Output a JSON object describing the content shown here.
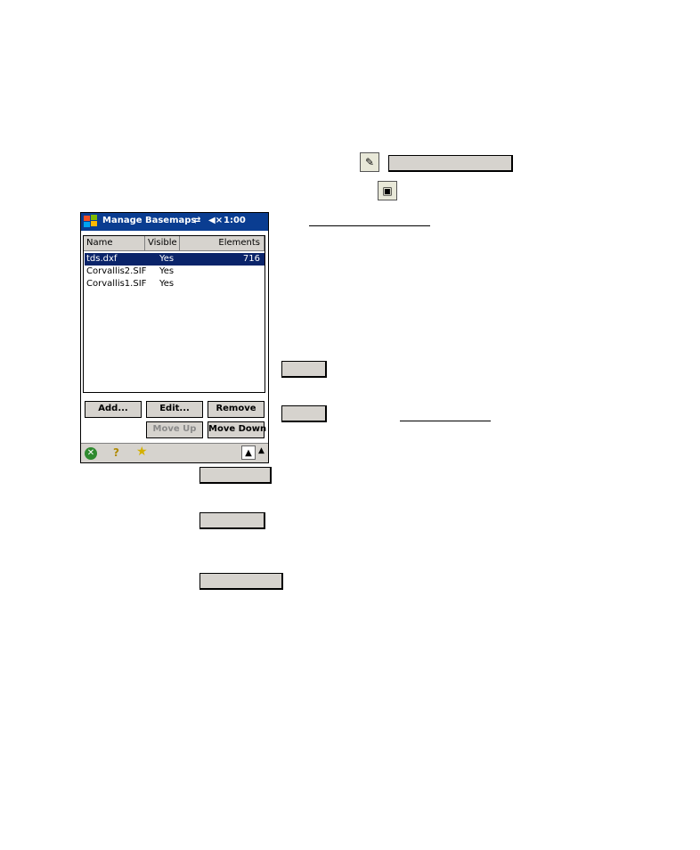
{
  "window": {
    "title": "Manage Basemaps",
    "connectivity_icon": "sync-arrows-icon",
    "volume_icon": "speaker-muted-icon",
    "time": "1:00"
  },
  "list": {
    "columns": [
      "Name",
      "Visible",
      "Elements"
    ],
    "rows": [
      {
        "name": "tds.dxf",
        "visible": "Yes",
        "elements": "716",
        "selected": true
      },
      {
        "name": "Corvallis2.SIF",
        "visible": "Yes",
        "elements": ""
      },
      {
        "name": "Corvallis1.SIF",
        "visible": "Yes",
        "elements": ""
      }
    ]
  },
  "buttons": {
    "add": "Add...",
    "edit": "Edit...",
    "remove": "Remove",
    "move_up": "Move Up",
    "move_down": "Move Down"
  },
  "taskbar": {
    "close_icon": "ok-close-icon",
    "help_icon": "help-icon",
    "favorites_icon": "star-icon",
    "sip_icon": "input-panel-icon"
  },
  "colors": {
    "titlebar": "#0a3d91",
    "selection": "#0a246a",
    "button_face": "#d6d3ce"
  }
}
